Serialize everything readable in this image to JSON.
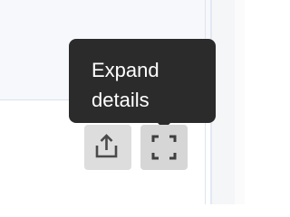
{
  "tooltip": {
    "line1": "Expand",
    "line2": "details"
  },
  "buttons": [
    {
      "name": "share-button",
      "icon": "share-icon"
    },
    {
      "name": "expand-details-button",
      "icon": "expand-icon"
    }
  ],
  "colors": {
    "tooltip_bg": "#2b2b2b",
    "tooltip_text": "#ffffff",
    "button_bg": "#dddddd",
    "icon": "#4a4a4a"
  }
}
